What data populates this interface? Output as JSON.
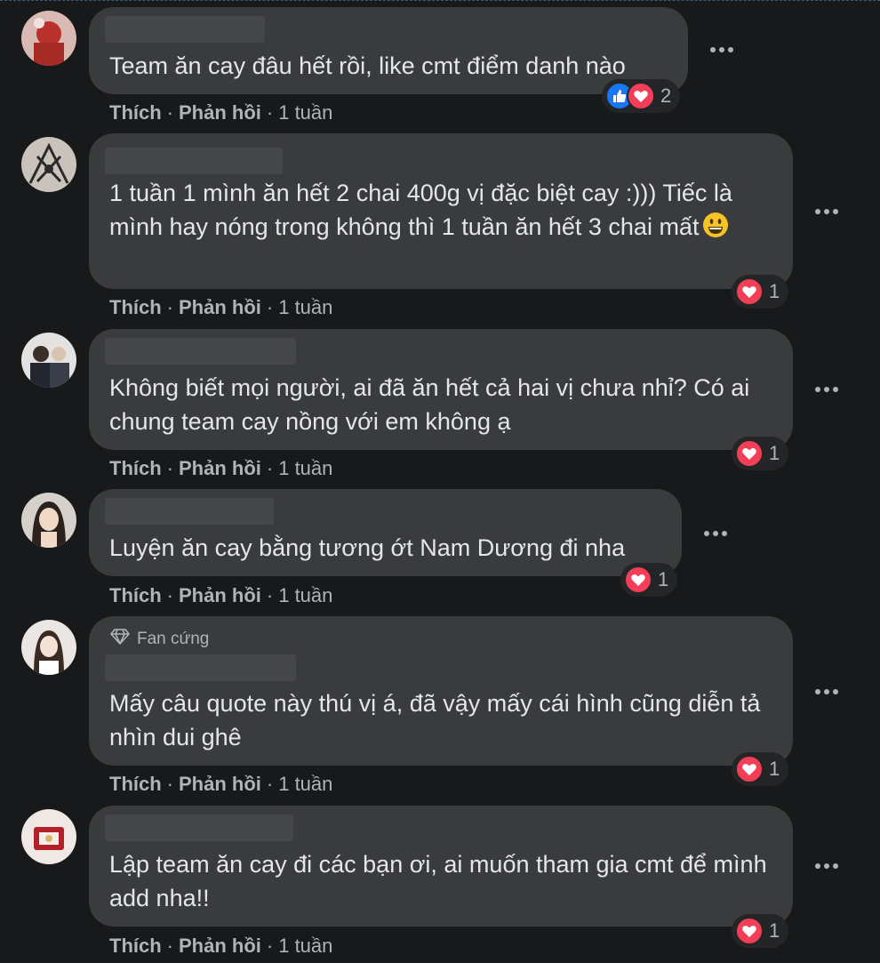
{
  "actions": {
    "like": "Thích",
    "reply": "Phản hồi",
    "dot": "·"
  },
  "comments": [
    {
      "text": "Team ăn cay đâu hết rồi, like cmt điểm danh nào",
      "time": "1 tuần",
      "reactions": [
        "like-icon",
        "love-icon"
      ],
      "reaction_count": "2"
    },
    {
      "text": "1 tuần 1 mình ăn hết 2 chai 400g vị đặc biệt cay :))) Tiếc là mình hay nóng trong không thì 1 tuần ăn hết 3 chai mất",
      "emoji": "grinning-face-emoji",
      "time": "1 tuần",
      "reactions": [
        "love-icon"
      ],
      "reaction_count": "1"
    },
    {
      "text": "Không biết mọi người, ai đã ăn hết cả hai vị chưa nhỉ? Có ai chung team cay nồng với em không ạ",
      "time": "1 tuần",
      "reactions": [
        "love-icon"
      ],
      "reaction_count": "1"
    },
    {
      "text": "Luyện ăn cay bằng tương ớt Nam Dương đi nha",
      "time": "1 tuần",
      "reactions": [
        "love-icon"
      ],
      "reaction_count": "1"
    },
    {
      "badge": "Fan cứng",
      "text": "Mấy câu quote này thú vị á, đã vậy mấy cái hình cũng diễn tả nhìn dui ghê",
      "time": "1 tuần",
      "reactions": [
        "love-icon"
      ],
      "reaction_count": "1"
    },
    {
      "text": "Lập team ăn cay đi các bạn ơi, ai muốn tham gia cmt để mình add nha!!",
      "time": "1 tuần",
      "reactions": [
        "love-icon"
      ],
      "reaction_count": "1"
    }
  ],
  "colors": {
    "background": "#18191a",
    "bubble": "#3a3b3c",
    "like": "#1877f2",
    "love": "#f33e58",
    "secondary_text": "#b0b3b8"
  }
}
